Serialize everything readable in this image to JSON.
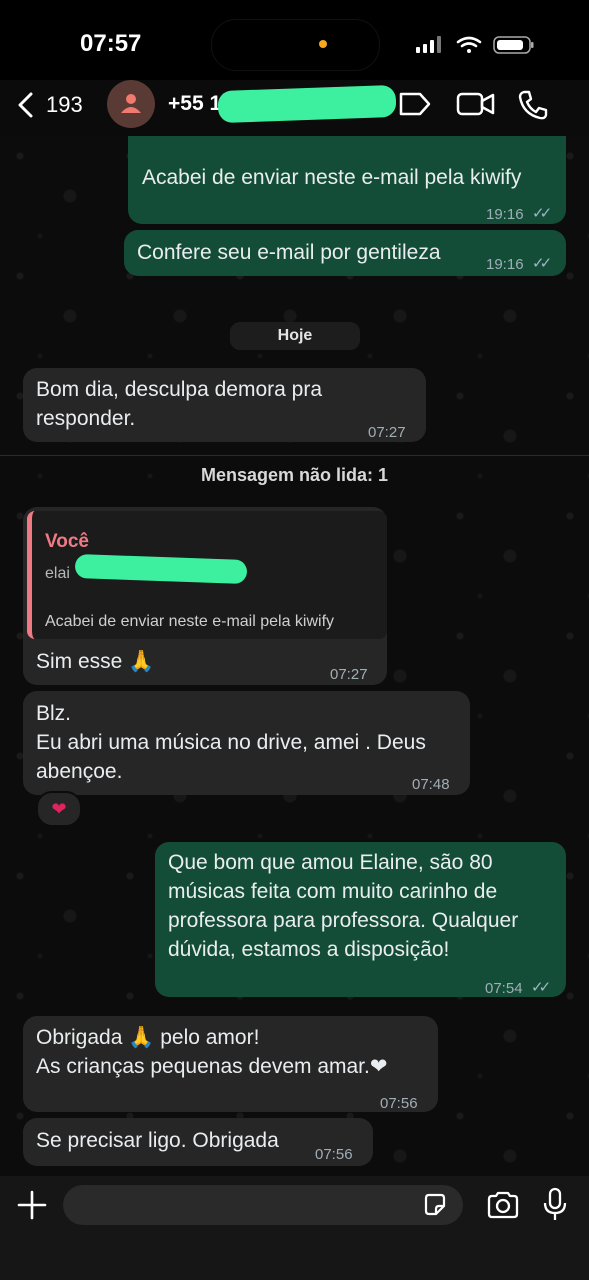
{
  "status_bar": {
    "time": "07:57"
  },
  "header": {
    "back_count": "193",
    "contact_name": "+55 11 9"
  },
  "messages": [
    {
      "dir": "out",
      "text": "Acabei de enviar neste e-mail pela kiwify",
      "time": "19:16",
      "read": "✓✓"
    },
    {
      "dir": "out",
      "text": "Confere seu e-mail por gentileza",
      "time": "19:16",
      "read": "✓✓"
    },
    {
      "dir": "in",
      "text": "Bom dia, desculpa demora pra responder.",
      "time": "07:27"
    },
    {
      "dir": "in",
      "quote_author": "Você",
      "quote_line1": "elai",
      "quote_text": "Acabei de enviar neste e-mail pela kiwify",
      "text": "Sim esse 🙏",
      "time": "07:27"
    },
    {
      "dir": "in",
      "text": "Blz.\nEu abri uma música no drive, amei . Deus abençoe.",
      "time": "07:48",
      "reaction": "❤"
    },
    {
      "dir": "out",
      "text": "Que bom que amou Elaine, são 80 músicas feita com muito carinho de professora para professora. Qualquer dúvida, estamos a disposição!",
      "time": "07:54",
      "read": "✓✓"
    },
    {
      "dir": "in",
      "text": "Obrigada 🙏 pelo amor!\nAs crianças pequenas devem amar.❤",
      "time": "07:56"
    },
    {
      "dir": "in",
      "text": "Se precisar ligo. Obrigada",
      "time": "07:56"
    }
  ],
  "labels": {
    "date_pill": "Hoje",
    "unread_banner": "Mensagem não lida: 1"
  },
  "colors": {
    "outgoing_bubble": "#144d37",
    "incoming_bubble": "#262626",
    "quote_accent": "#f07a84",
    "redaction": "#3df0a0"
  },
  "icons": [
    "back-chevron-icon",
    "person-icon",
    "label-icon",
    "video-call-icon",
    "phone-icon",
    "plus-icon",
    "sticker-icon",
    "camera-icon",
    "microphone-icon"
  ]
}
